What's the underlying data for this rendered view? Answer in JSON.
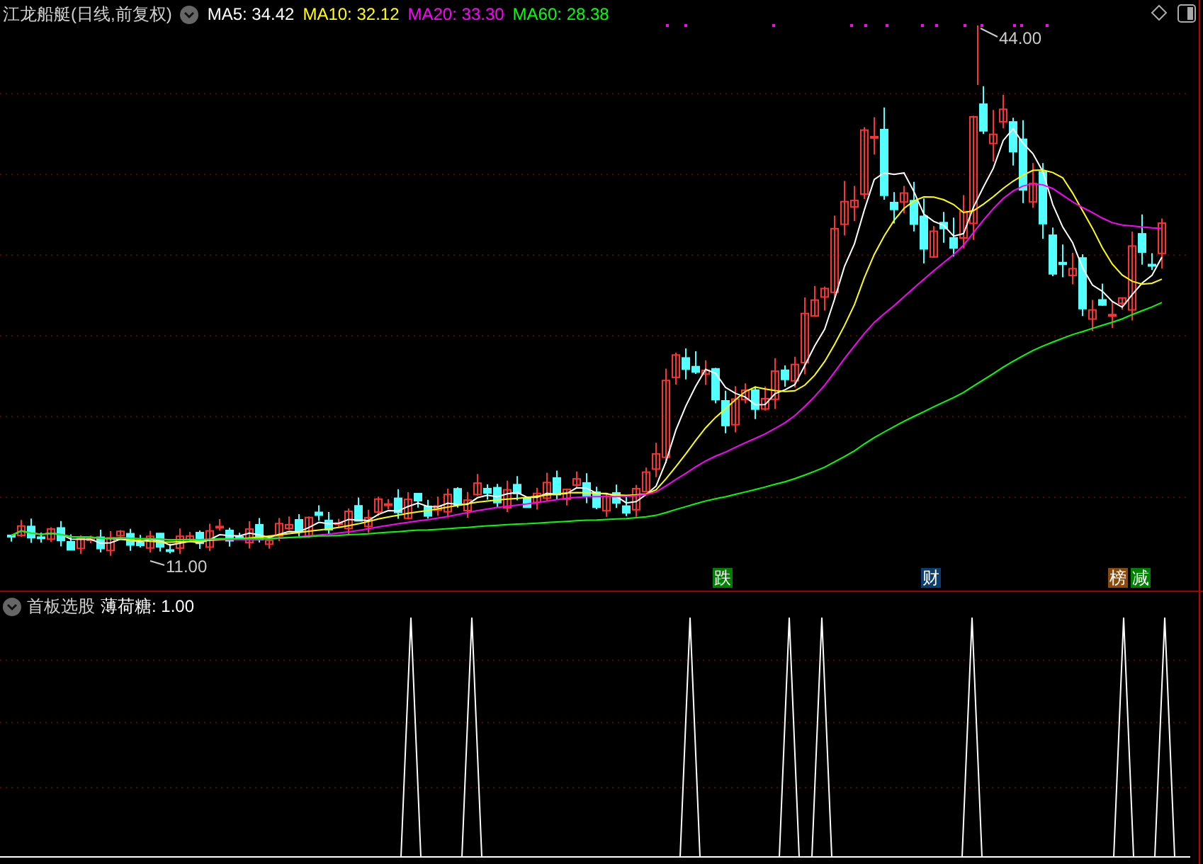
{
  "header": {
    "title": "江龙船艇(日线,前复权)",
    "indicators": [
      {
        "label": "MA5: 34.42",
        "color": "#ffffff"
      },
      {
        "label": "MA10: 32.12",
        "color": "#ffff00"
      },
      {
        "label": "MA20: 33.30",
        "color": "#ff00ff"
      },
      {
        "label": "MA60: 28.38",
        "color": "#00ff00"
      }
    ]
  },
  "chart": {
    "high_label": "44.00",
    "low_label": "11.00",
    "markers": [
      {
        "label": "跌",
        "color": "#008000"
      },
      {
        "label": "财",
        "color": "#0b3c6e"
      },
      {
        "label": "榜",
        "color": "#8b4a0c"
      },
      {
        "label": "减",
        "color": "#008000"
      }
    ]
  },
  "indicator_pane": {
    "name": "首板选股",
    "value": "薄荷糖: 1.00"
  }
}
